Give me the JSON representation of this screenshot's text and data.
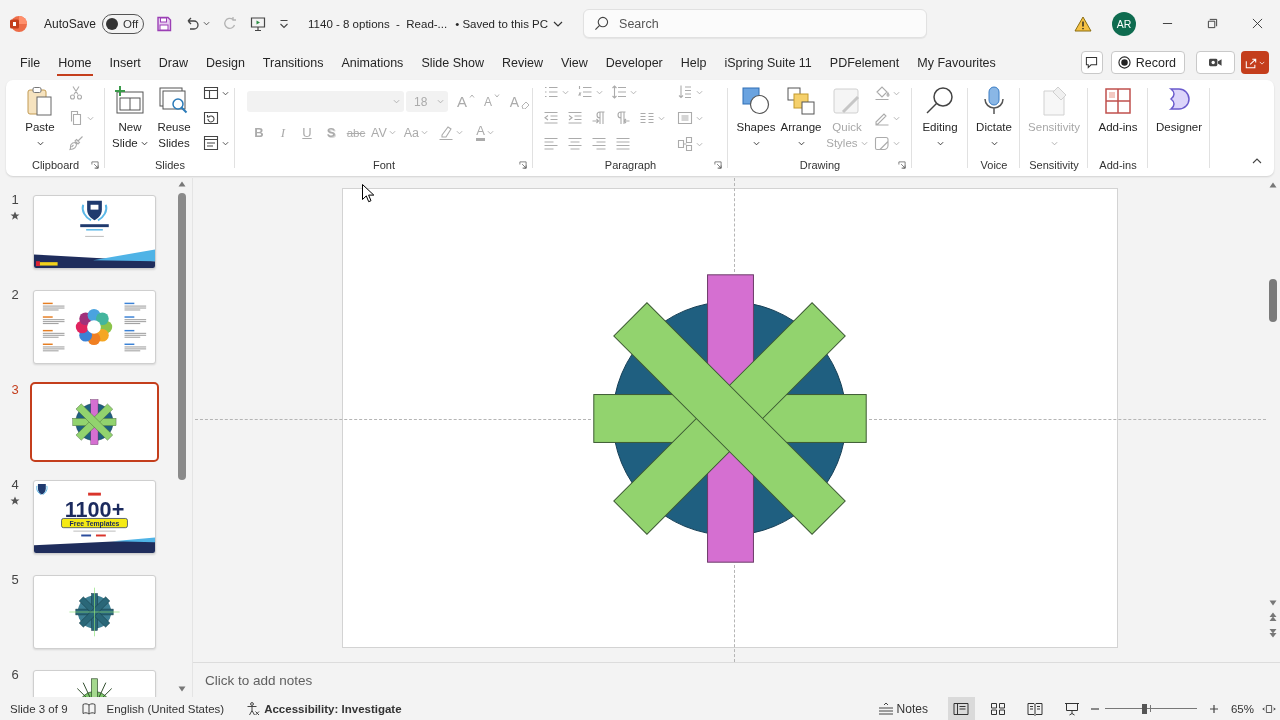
{
  "titlebar": {
    "autosave_label": "AutoSave",
    "autosave": {
      "on": false,
      "label": "Off"
    },
    "redo_disabled": true,
    "document_title": "1140 - 8 options  -  Read-...",
    "save_status": "• Saved to this PC",
    "search": {
      "placeholder": "Search"
    },
    "avatar_initials": "AR"
  },
  "tabs": [
    {
      "label": "File",
      "selected": false
    },
    {
      "label": "Home",
      "selected": true
    },
    {
      "label": "Insert",
      "selected": false
    },
    {
      "label": "Draw",
      "selected": false
    },
    {
      "label": "Design",
      "selected": false
    },
    {
      "label": "Transitions",
      "selected": false
    },
    {
      "label": "Animations",
      "selected": false
    },
    {
      "label": "Slide Show",
      "selected": false
    },
    {
      "label": "Review",
      "selected": false
    },
    {
      "label": "View",
      "selected": false
    },
    {
      "label": "Developer",
      "selected": false
    },
    {
      "label": "Help",
      "selected": false
    },
    {
      "label": "iSpring Suite 11",
      "selected": false
    },
    {
      "label": "PDFelement",
      "selected": false
    },
    {
      "label": "My Favourites",
      "selected": false
    }
  ],
  "tab_actions": {
    "record": "Record"
  },
  "ribbon": {
    "groups": [
      {
        "label": "Clipboard",
        "tools_disabled": true,
        "buttons": [
          {
            "label": "Paste",
            "disabled": false,
            "menu": true
          }
        ]
      },
      {
        "label": "Slides",
        "tools_disabled": false,
        "buttons": [
          {
            "label": "New Slide",
            "disabled": false,
            "menu": true
          },
          {
            "label": "Reuse Slides",
            "disabled": false,
            "menu": false
          }
        ]
      },
      {
        "label": "Font",
        "tools_disabled": true,
        "font_size": "18",
        "tools": [
          {
            "kind": "grow",
            "glyph": "A"
          },
          {
            "kind": "shrink",
            "glyph": "A"
          },
          {
            "kind": "clear",
            "glyph": "A"
          },
          {
            "kind": "bold",
            "glyph": "B"
          },
          {
            "kind": "italic",
            "glyph": "I"
          },
          {
            "kind": "underline",
            "glyph": "U"
          },
          {
            "kind": "shadow",
            "glyph": "S"
          },
          {
            "kind": "strike",
            "glyph": "abc"
          },
          {
            "kind": "spacing",
            "glyph": "AV"
          },
          {
            "kind": "case",
            "glyph": "Aa"
          },
          {
            "kind": "highlight"
          },
          {
            "kind": "color",
            "glyph": "A"
          }
        ]
      },
      {
        "label": "Paragraph",
        "tools_disabled": true
      },
      {
        "label": "Drawing",
        "tools_disabled": true,
        "buttons": [
          {
            "label": "Shapes",
            "disabled": false,
            "menu": true
          },
          {
            "label": "Arrange",
            "disabled": false,
            "menu": true
          },
          {
            "label": "Quick Styles",
            "disabled": true,
            "menu": true
          }
        ]
      },
      {
        "buttons": [
          {
            "label": "Editing",
            "disabled": false,
            "menu": true
          }
        ]
      },
      {
        "label": "Voice",
        "buttons": [
          {
            "label": "Dictate",
            "disabled": false,
            "menu": true
          }
        ]
      },
      {
        "label": "Sensitivity",
        "buttons": [
          {
            "label": "Sensitivity",
            "disabled": true,
            "menu": true
          }
        ]
      },
      {
        "label": "Add-ins",
        "buttons": [
          {
            "label": "Add-ins",
            "disabled": false,
            "menu": false
          }
        ]
      },
      {
        "buttons": [
          {
            "label": "Designer",
            "disabled": false,
            "menu": false
          }
        ]
      }
    ]
  },
  "slides": [
    {
      "number": "1",
      "selected": false,
      "starred": true
    },
    {
      "number": "2",
      "selected": false,
      "starred": false
    },
    {
      "number": "3",
      "selected": true,
      "starred": false
    },
    {
      "number": "4",
      "selected": false,
      "starred": true,
      "heading": "1100+",
      "tag": "Free Templates"
    },
    {
      "number": "5",
      "selected": false,
      "starred": false
    },
    {
      "number": "6",
      "selected": false,
      "starred": false
    }
  ],
  "notes": {
    "placeholder": "Click to add notes"
  },
  "status_bar": {
    "slide_info": "Slide 3 of 9",
    "language": "English (United States)",
    "accessibility": "Accessibility: Investigate",
    "notes_button": "Notes",
    "views": [
      {
        "selected": true
      },
      {
        "selected": false
      },
      {
        "selected": false
      },
      {
        "selected": false
      }
    ],
    "zoom": {
      "level": 0.42,
      "reading": "65%"
    }
  }
}
